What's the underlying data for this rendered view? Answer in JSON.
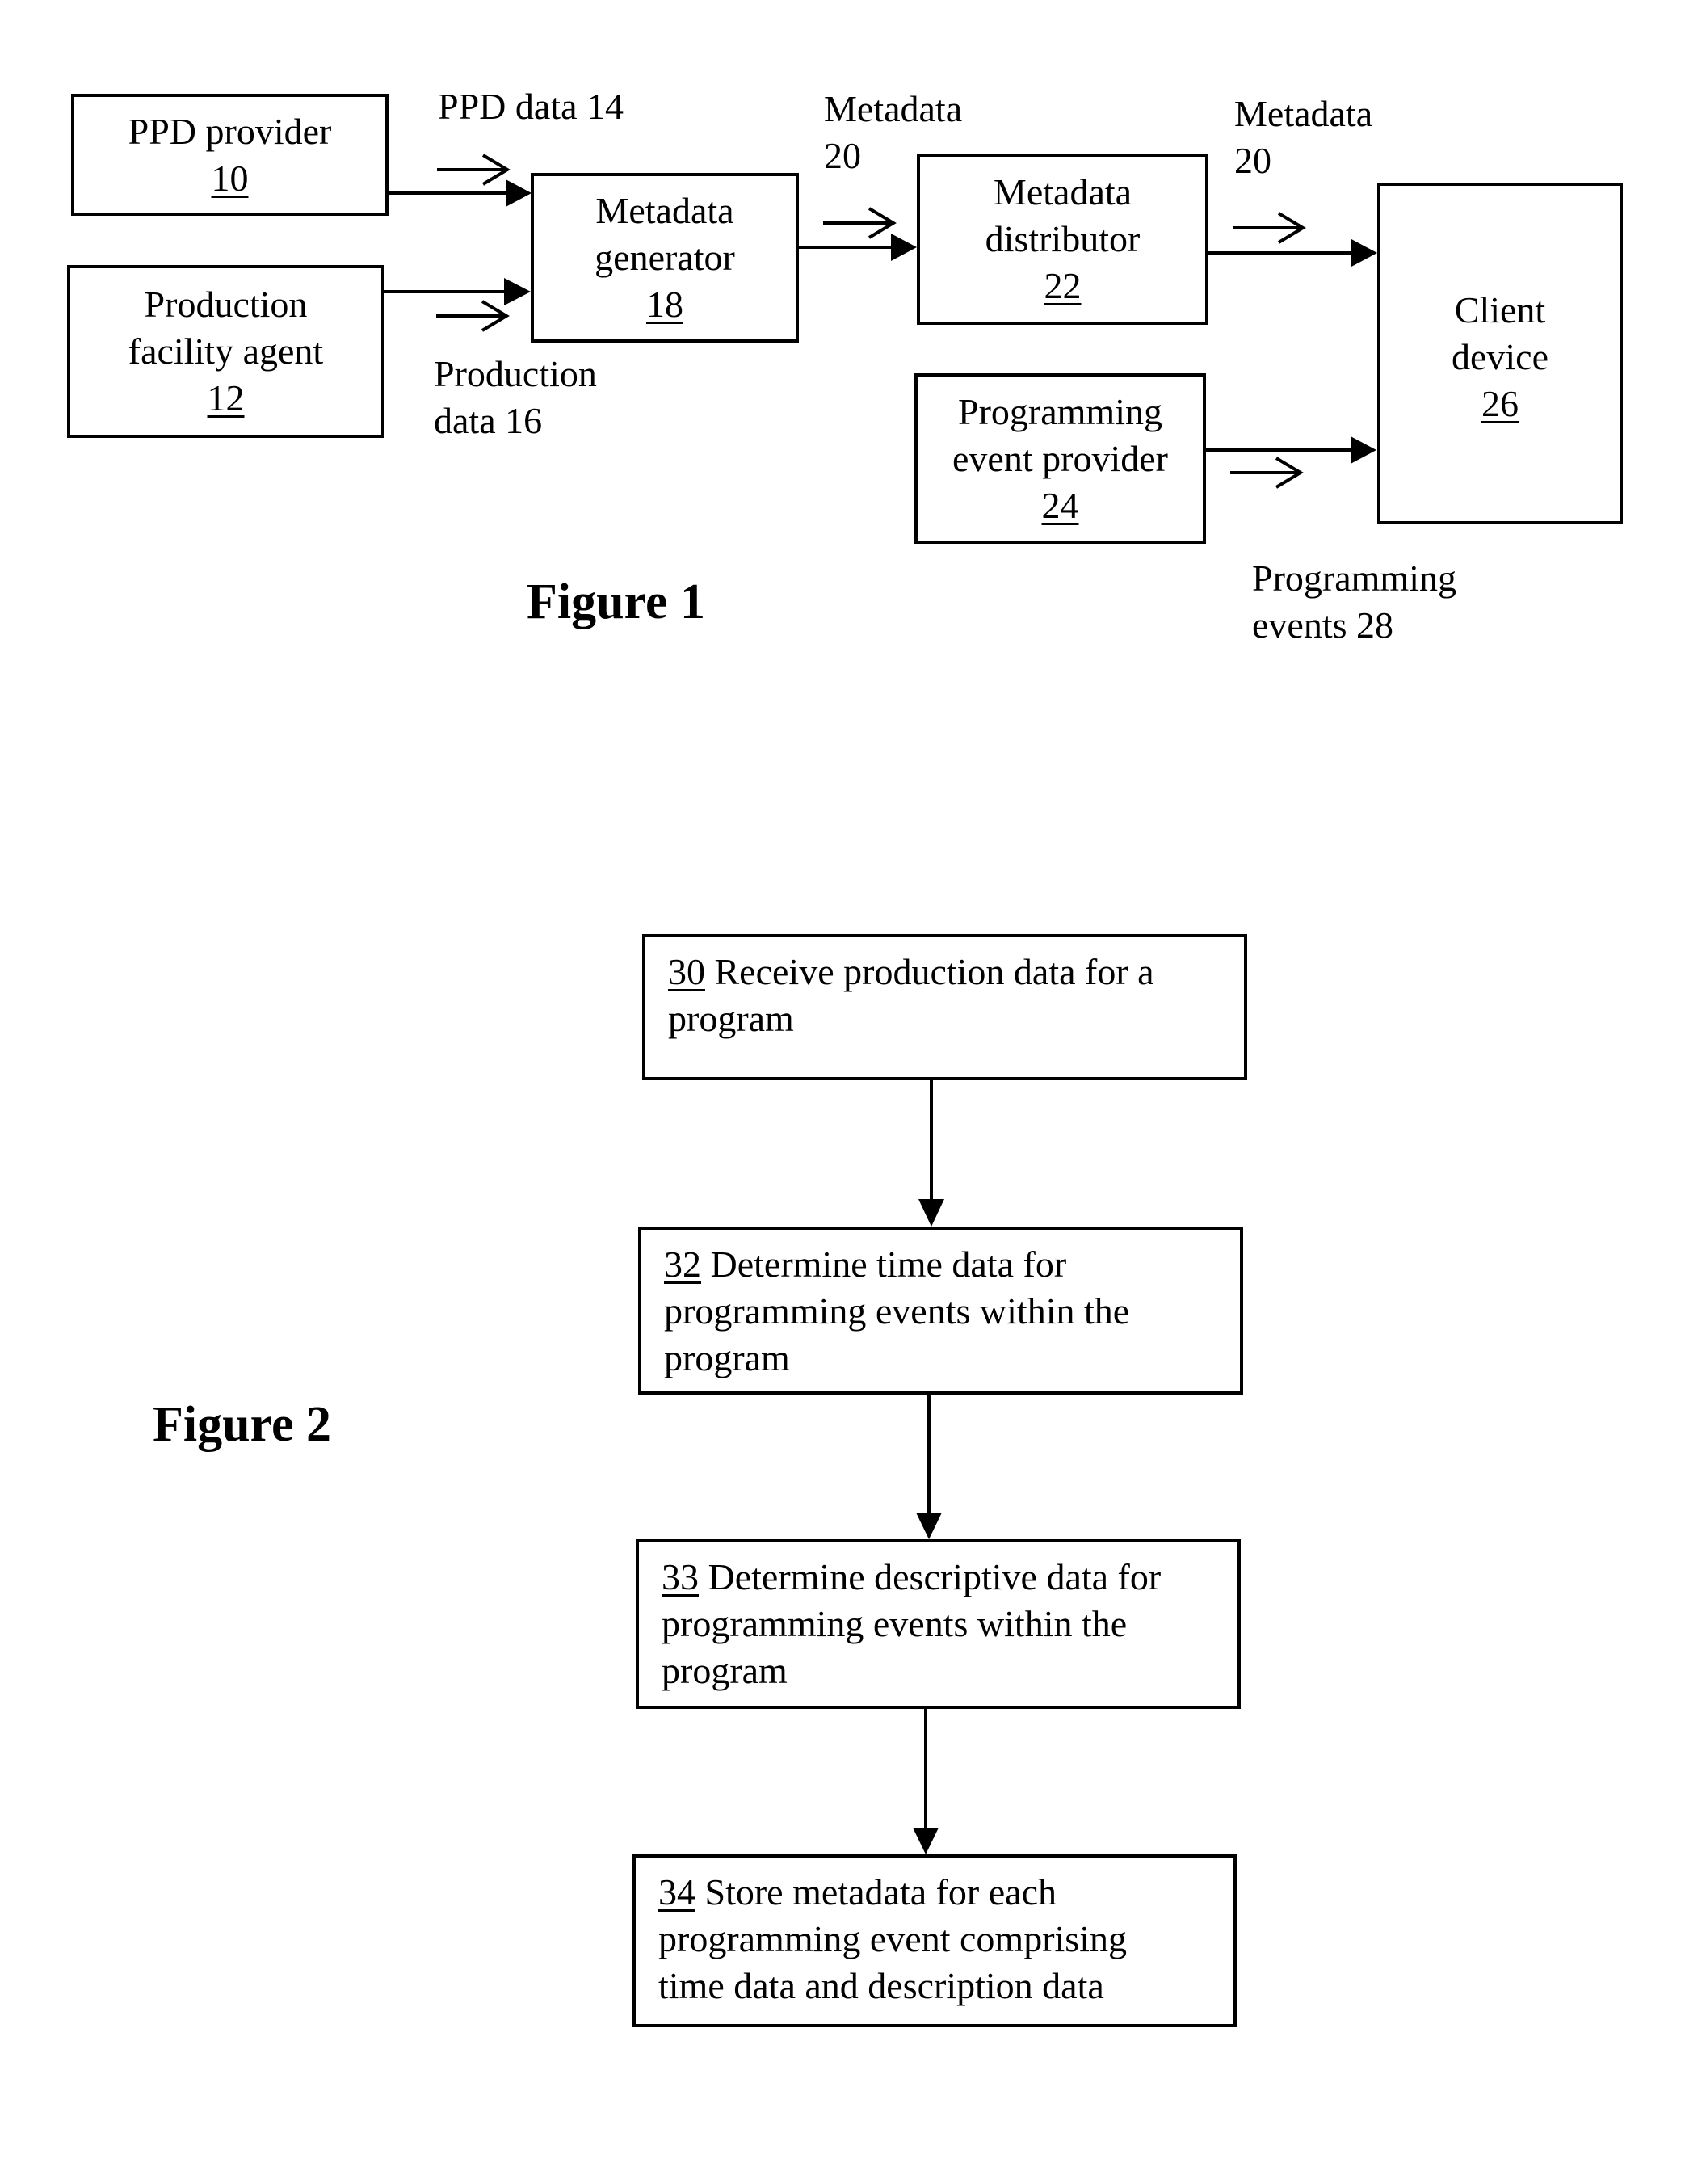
{
  "figure1": {
    "title": "Figure 1",
    "boxes": {
      "ppd_provider": {
        "label_lines": [
          "PPD provider"
        ],
        "ref": "10"
      },
      "production_facility_agent": {
        "label_lines": [
          "Production",
          "facility agent"
        ],
        "ref": "12"
      },
      "metadata_generator": {
        "label_lines": [
          "Metadata",
          "generator"
        ],
        "ref": "18"
      },
      "metadata_distributor": {
        "label_lines": [
          "Metadata",
          "distributor"
        ],
        "ref": "22"
      },
      "programming_event_provider": {
        "label_lines": [
          "Programming",
          "event provider"
        ],
        "ref": "24"
      },
      "client_device": {
        "label_lines": [
          "Client",
          "device"
        ],
        "ref": "26"
      }
    },
    "flow_labels": {
      "ppd_data": [
        "PPD data 14"
      ],
      "production_data": [
        "Production",
        "data 16"
      ],
      "metadata_in": [
        "Metadata",
        "20"
      ],
      "metadata_out": [
        "Metadata",
        "20"
      ],
      "programming_events": [
        "Programming",
        "events 28"
      ]
    },
    "connections": [
      {
        "from": "PPD provider 10",
        "to": "Metadata generator 18",
        "carries": "PPD data 14"
      },
      {
        "from": "Production facility agent 12",
        "to": "Metadata generator 18",
        "carries": "Production data 16"
      },
      {
        "from": "Metadata generator 18",
        "to": "Metadata distributor 22",
        "carries": "Metadata 20"
      },
      {
        "from": "Metadata distributor 22",
        "to": "Client device 26",
        "carries": "Metadata 20"
      },
      {
        "from": "Programming event provider 24",
        "to": "Client device 26",
        "carries": "Programming events 28"
      }
    ]
  },
  "figure2": {
    "title": "Figure 2",
    "steps": [
      {
        "num": "30",
        "lines": [
          " Receive production data for a",
          "program"
        ]
      },
      {
        "num": "32",
        "lines": [
          " Determine time data for",
          "programming events within the",
          "program"
        ]
      },
      {
        "num": "33",
        "lines": [
          " Determine descriptive data for",
          "programming events within the",
          "program"
        ]
      },
      {
        "num": "34",
        "lines": [
          " Store metadata for each",
          "programming event comprising",
          "time data and description data"
        ]
      }
    ]
  }
}
